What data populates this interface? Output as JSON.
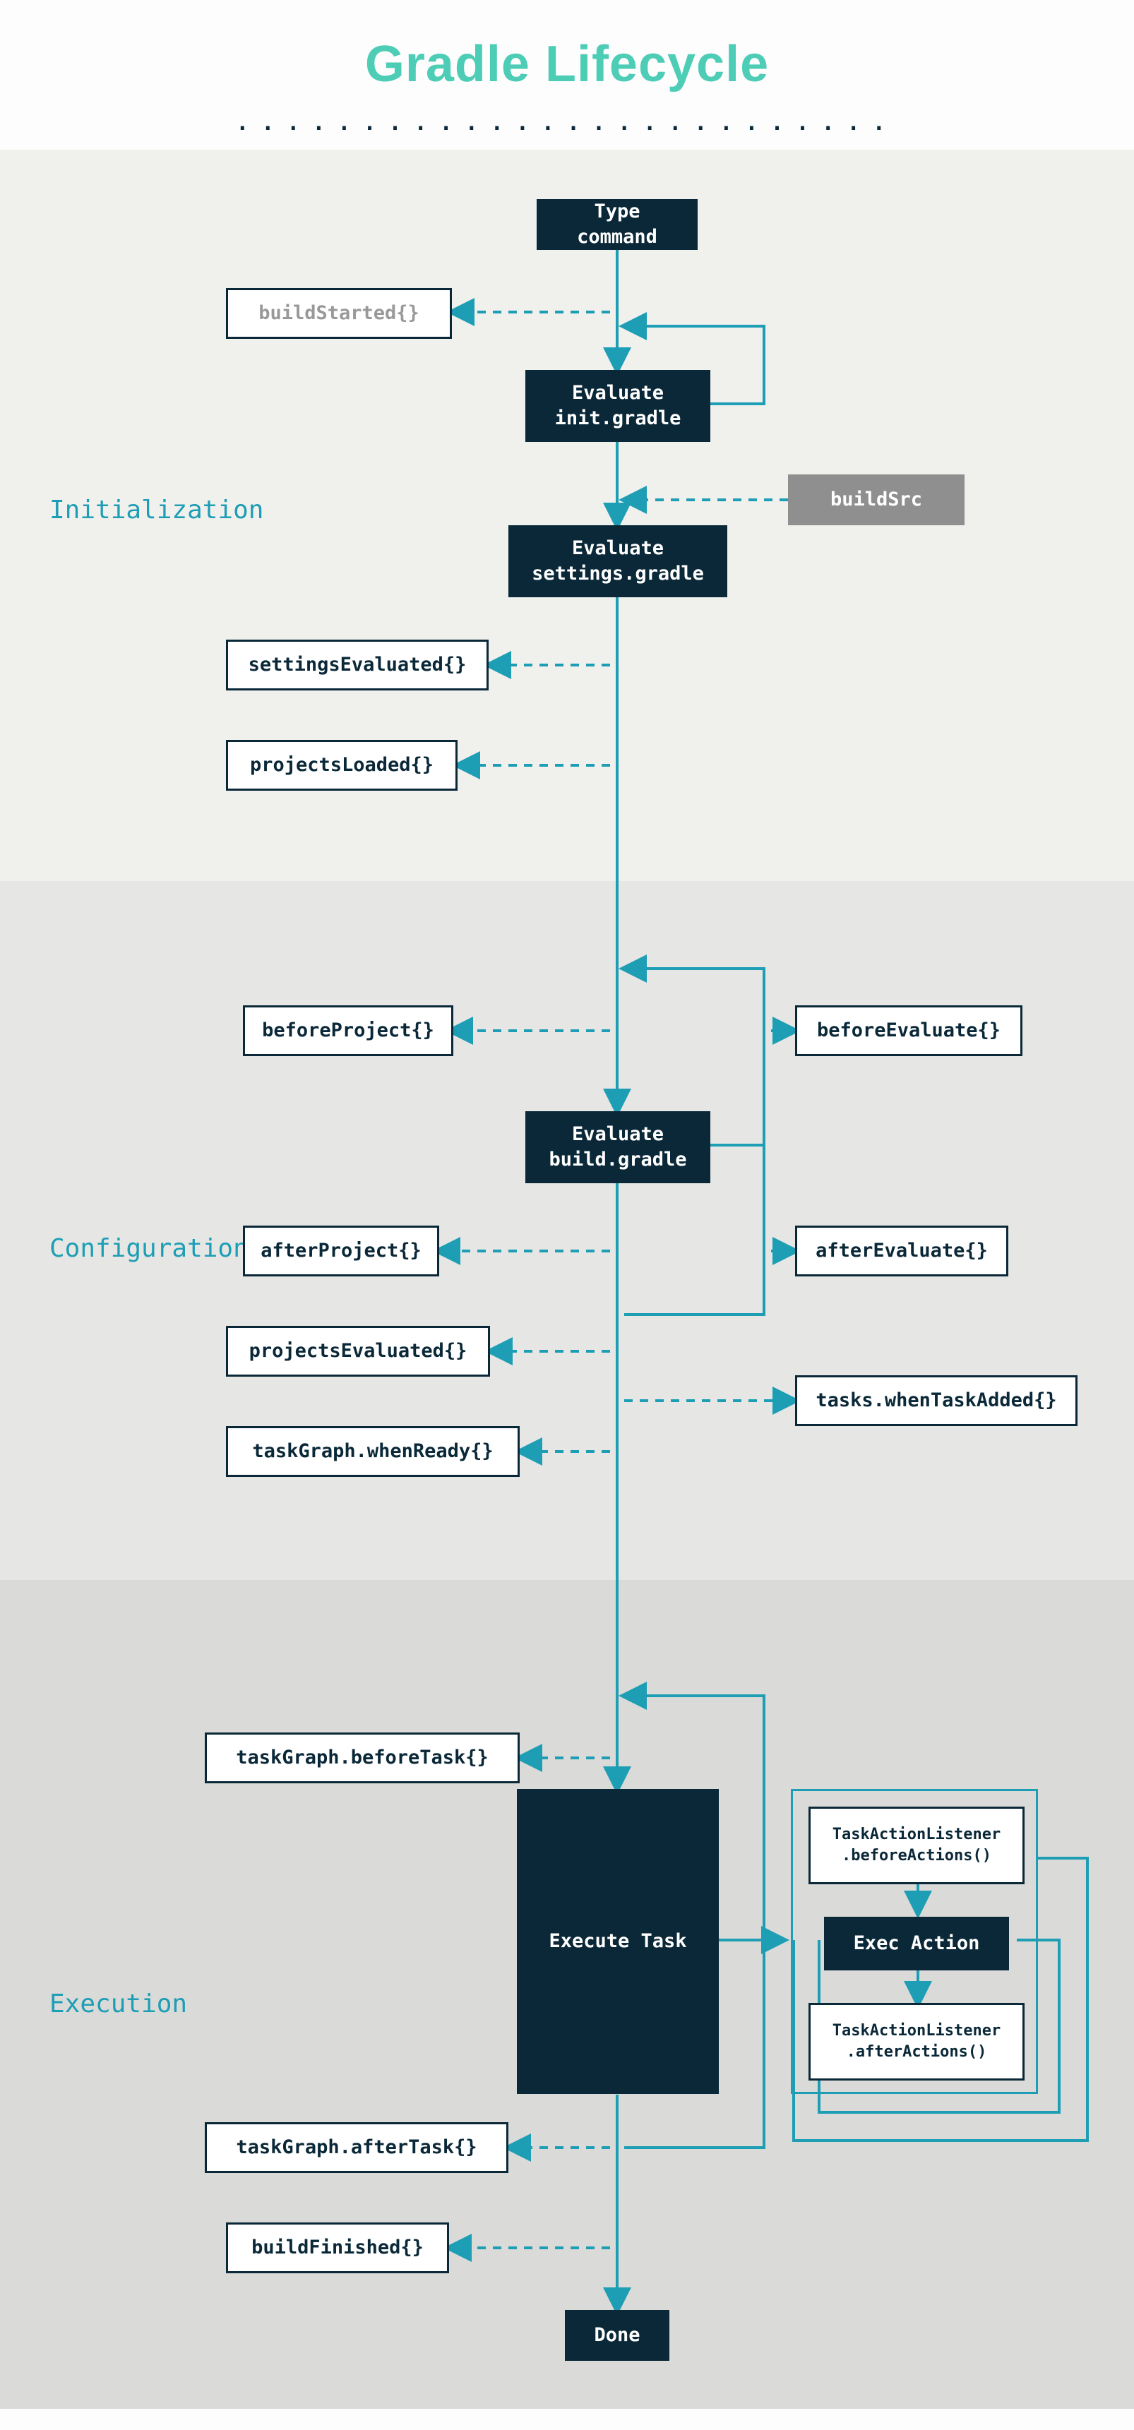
{
  "header": {
    "title": "Gradle Lifecycle"
  },
  "phases": {
    "init": {
      "label": "Initialization"
    },
    "config": {
      "label": "Configuration"
    },
    "exec": {
      "label": "Execution"
    }
  },
  "nodes": {
    "type_command": "Type command",
    "build_started": "buildStarted{}",
    "eval_init": "Evaluate\ninit.gradle",
    "buildsrc": "buildSrc",
    "eval_settings": "Evaluate\nsettings.gradle",
    "settings_evaluated": "settingsEvaluated{}",
    "projects_loaded": "projectsLoaded{}",
    "before_project": "beforeProject{}",
    "before_evaluate": "beforeEvaluate{}",
    "eval_build": "Evaluate\nbuild.gradle",
    "after_project": "afterProject{}",
    "after_evaluate": "afterEvaluate{}",
    "projects_evaluated": "projectsEvaluated{}",
    "tasks_when_added": "tasks.whenTaskAdded{}",
    "taskgraph_when_ready": "taskGraph.whenReady{}",
    "taskgraph_before_task": "taskGraph.beforeTask{}",
    "execute_task": "Execute Task",
    "tal_before": "TaskActionListener\n.beforeActions()",
    "exec_action": "Exec Action",
    "tal_after": "TaskActionListener\n.afterActions()",
    "taskgraph_after_task": "taskGraph.afterTask{}",
    "build_finished": "buildFinished{}",
    "done": "Done"
  },
  "colors": {
    "teal": "#1d9eb5",
    "dark": "#0a2838",
    "mint": "#4ecdb6"
  }
}
